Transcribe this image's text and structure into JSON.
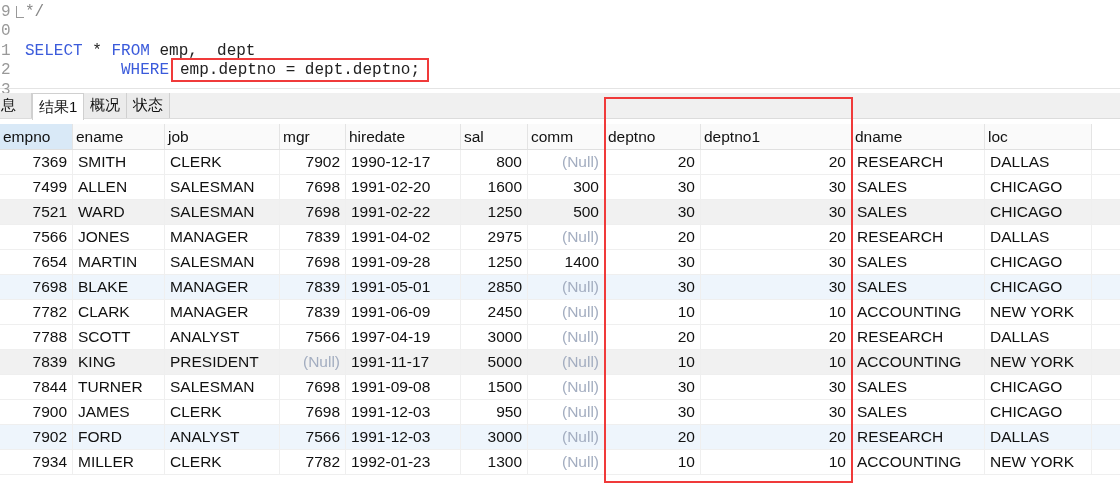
{
  "editor": {
    "lines": [
      {
        "number": "9",
        "fold": true,
        "tokens": [
          {
            "kind": "comment",
            "text": "*/"
          }
        ]
      },
      {
        "number": "0"
      },
      {
        "number": "1",
        "tokens": [
          {
            "kind": "keyword",
            "text": "SELECT"
          },
          {
            "kind": "plain",
            "text": " * "
          },
          {
            "kind": "keyword",
            "text": "FROM"
          },
          {
            "kind": "plain",
            "text": " emp,  dept"
          }
        ]
      },
      {
        "number": "2",
        "indented": true,
        "tokens": [
          {
            "kind": "keyword",
            "text": "WHERE"
          },
          {
            "kind": "plain",
            "text": "emp.deptno = dept.deptno;",
            "boxed": true
          }
        ]
      },
      {
        "number": "3"
      }
    ]
  },
  "tabs": [
    {
      "label": "息",
      "selected": false
    },
    {
      "label": "结果1",
      "selected": true
    },
    {
      "label": "概况",
      "selected": false
    },
    {
      "label": "状态",
      "selected": false
    }
  ],
  "table": {
    "columns": [
      {
        "label": "empno",
        "kind": "number",
        "selected": true
      },
      {
        "label": "ename",
        "kind": "text",
        "selected": false
      },
      {
        "label": "job",
        "kind": "text",
        "selected": false
      },
      {
        "label": "mgr",
        "kind": "number",
        "selected": false
      },
      {
        "label": "hiredate",
        "kind": "text",
        "selected": false
      },
      {
        "label": "sal",
        "kind": "number",
        "selected": false
      },
      {
        "label": "comm",
        "kind": "number",
        "selected": false
      },
      {
        "label": "deptno",
        "kind": "number",
        "selected": false,
        "boxed": true
      },
      {
        "label": "deptno1",
        "kind": "number",
        "selected": false,
        "boxed": true
      },
      {
        "label": "dname",
        "kind": "text",
        "selected": false
      },
      {
        "label": "loc",
        "kind": "text",
        "selected": false
      }
    ],
    "rows": [
      {
        "selected": false,
        "striped": false,
        "cells": [
          "7369",
          "SMITH",
          "CLERK",
          "7902",
          "1990-12-17",
          "800",
          {
            "text": "(Null)",
            "null": true
          },
          "20",
          "20",
          "RESEARCH",
          "DALLAS"
        ]
      },
      {
        "selected": false,
        "striped": false,
        "cells": [
          "7499",
          "ALLEN",
          "SALESMAN",
          "7698",
          "1991-02-20",
          "1600",
          "300",
          "30",
          "30",
          "SALES",
          "CHICAGO"
        ]
      },
      {
        "selected": false,
        "striped": true,
        "cells": [
          "7521",
          "WARD",
          "SALESMAN",
          "7698",
          "1991-02-22",
          "1250",
          "500",
          "30",
          "30",
          "SALES",
          "CHICAGO"
        ]
      },
      {
        "selected": false,
        "striped": false,
        "cells": [
          "7566",
          "JONES",
          "MANAGER",
          "7839",
          "1991-04-02",
          "2975",
          {
            "text": "(Null)",
            "null": true
          },
          "20",
          "20",
          "RESEARCH",
          "DALLAS"
        ]
      },
      {
        "selected": false,
        "striped": false,
        "cells": [
          "7654",
          "MARTIN",
          "SALESMAN",
          "7698",
          "1991-09-28",
          "1250",
          "1400",
          "30",
          "30",
          "SALES",
          "CHICAGO"
        ]
      },
      {
        "selected": true,
        "striped": false,
        "cells": [
          "7698",
          "BLAKE",
          "MANAGER",
          "7839",
          "1991-05-01",
          "2850",
          {
            "text": "(Null)",
            "null": true
          },
          "30",
          "30",
          "SALES",
          "CHICAGO"
        ]
      },
      {
        "selected": false,
        "striped": false,
        "cells": [
          "7782",
          "CLARK",
          "MANAGER",
          "7839",
          "1991-06-09",
          "2450",
          {
            "text": "(Null)",
            "null": true
          },
          "10",
          "10",
          "ACCOUNTING",
          "NEW YORK"
        ]
      },
      {
        "selected": false,
        "striped": false,
        "cells": [
          "7788",
          "SCOTT",
          "ANALYST",
          "7566",
          "1997-04-19",
          "3000",
          {
            "text": "(Null)",
            "null": true
          },
          "20",
          "20",
          "RESEARCH",
          "DALLAS"
        ]
      },
      {
        "selected": false,
        "striped": true,
        "cells": [
          "7839",
          "KING",
          "PRESIDENT",
          {
            "text": "(Null)",
            "null": true
          },
          "1991-11-17",
          "5000",
          {
            "text": "(Null)",
            "null": true
          },
          "10",
          "10",
          "ACCOUNTING",
          "NEW YORK"
        ]
      },
      {
        "selected": false,
        "striped": false,
        "cells": [
          "7844",
          "TURNER",
          "SALESMAN",
          "7698",
          "1991-09-08",
          "1500",
          {
            "text": "(Null)",
            "null": true
          },
          "30",
          "30",
          "SALES",
          "CHICAGO"
        ]
      },
      {
        "selected": false,
        "striped": false,
        "cells": [
          "7900",
          "JAMES",
          "CLERK",
          "7698",
          "1991-12-03",
          "950",
          {
            "text": "(Null)",
            "null": true
          },
          "30",
          "30",
          "SALES",
          "CHICAGO"
        ]
      },
      {
        "selected": true,
        "striped": false,
        "cells": [
          "7902",
          "FORD",
          "ANALYST",
          "7566",
          "1991-12-03",
          "3000",
          {
            "text": "(Null)",
            "null": true
          },
          "20",
          "20",
          "RESEARCH",
          "DALLAS"
        ]
      },
      {
        "selected": false,
        "striped": false,
        "cells": [
          "7934",
          "MILLER",
          "CLERK",
          "7782",
          "1992-01-23",
          "1300",
          {
            "text": "(Null)",
            "null": true
          },
          "10",
          "10",
          "ACCOUNTING",
          "NEW YORK"
        ]
      }
    ]
  }
}
